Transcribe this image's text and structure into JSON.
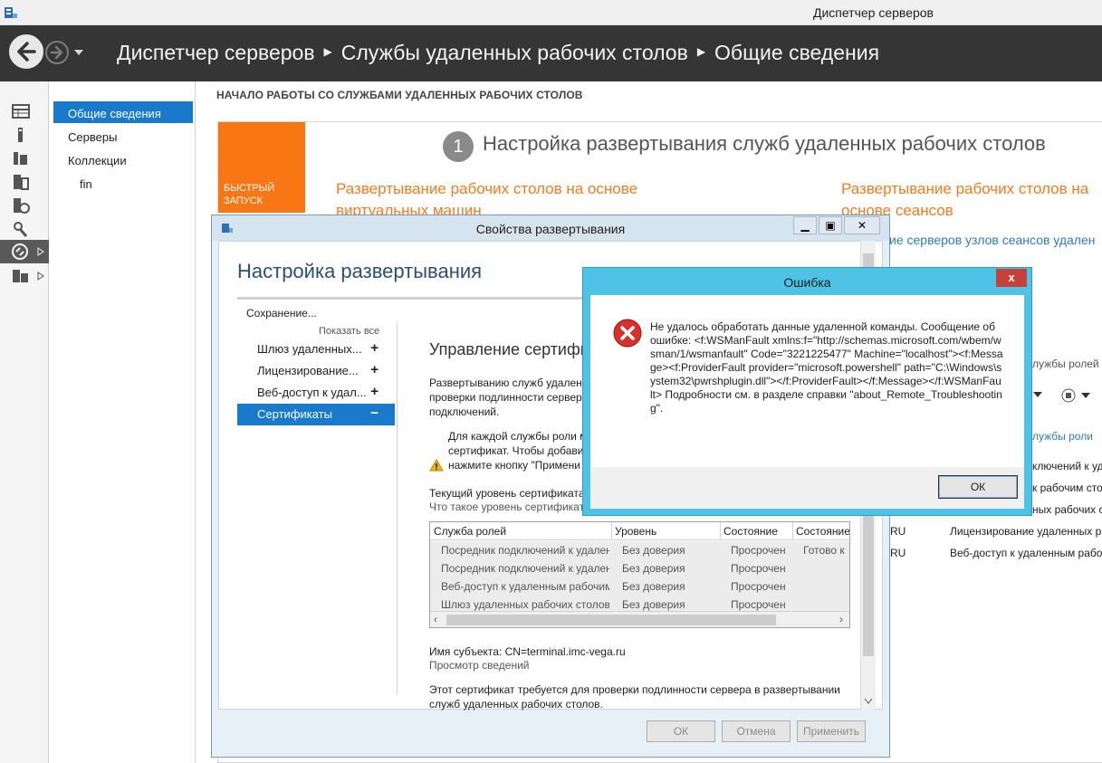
{
  "window": {
    "title": "Диспетчер серверов"
  },
  "nav": {
    "breadcrumb": [
      "Диспетчер серверов",
      "Службы удаленных рабочих столов",
      "Общие сведения"
    ]
  },
  "sidebar": {
    "items": [
      {
        "label": "Общие сведения",
        "active": true
      },
      {
        "label": "Серверы"
      },
      {
        "label": "Коллекции"
      },
      {
        "label": "fin"
      }
    ]
  },
  "main": {
    "heading": "НАЧАЛО РАБОТЫ СО СЛУЖБАМИ УДАЛЕННЫХ РАБОЧИХ СТОЛОВ",
    "quickstart_label": "БЫСТРЫЙ ЗАПУСК",
    "step_number": "1",
    "step_title": "Настройка развертывания служб удаленных рабочих столов",
    "link_vdi": "Развертывание рабочих столов на основе виртуальных машин",
    "link_session": "Развертывание рабочих столов на основе сеансов",
    "link_add_servers": "ие серверов узлов сеансов удален",
    "bg_role_services": "службы ролей уд",
    "bg_task_link": "службы роли",
    "bg_rows": [
      "ключений к удал",
      "к рабочим сто",
      "ных рабочих стол"
    ],
    "bg_ru": [
      "RU",
      "RU"
    ],
    "bg_roles": [
      "Лицензирование удаленных ра",
      "Веб-доступ к удаленным рабо"
    ]
  },
  "deploy_dialog": {
    "title": "Свойства развертывания",
    "heading": "Настройка развертывания",
    "status": "Сохранение...",
    "show_all": "Показать все",
    "nav": [
      {
        "label": "Шлюз удаленных...",
        "sign": "+"
      },
      {
        "label": "Лицензирование...",
        "sign": "+"
      },
      {
        "label": "Веб-доступ к удал...",
        "sign": "+"
      },
      {
        "label": "Сертификаты",
        "sign": "−",
        "active": true
      }
    ],
    "section_title": "Управление сертифи",
    "desc": [
      "Развертыванию служб удален",
      "проверки подлинности сервер",
      "подключений."
    ],
    "warning": [
      "Для каждой службы роли м",
      "сертификат. Чтобы добавит",
      "нажмите кнопку \"Примени"
    ],
    "cert_level_label": "Текущий уровень сертификата",
    "cert_level_link": "Что такое уровень сертификата",
    "grid": {
      "columns": [
        "Служба ролей",
        "Уровень",
        "Состояние",
        "Состояние"
      ],
      "rows": [
        [
          "Посредник подключений к удален",
          "Без доверия",
          "Просрочен",
          "Готово к"
        ],
        [
          "Посредник подключений к удален",
          "Без доверия",
          "Просрочен",
          ""
        ],
        [
          "Веб-доступ к удаленным рабочим",
          "Без доверия",
          "Просрочен",
          ""
        ],
        [
          "Шлюз удаленных рабочих столов",
          "Без доверия",
          "Просрочен",
          ""
        ]
      ]
    },
    "subject": "Имя субъекта: CN=terminal.imc-vega.ru",
    "view_details": "Просмотр сведений",
    "footer_text": [
      "Этот сертификат требуется для проверки подлинности сервера в развертывании",
      "служб удаленных рабочих столов."
    ],
    "buttons": {
      "ok": "ОК",
      "cancel": "Отмена",
      "apply": "Применить"
    }
  },
  "error_dialog": {
    "title": "Ошибка",
    "message": "Не удалось обработать данные удаленной команды. Сообщение об ошибке: <f:WSManFault xmlns:f=\"http://schemas.microsoft.com/wbem/wsman/1/wsmanfault\" Code=\"3221225477\" Machine=\"localhost\"><f:Message><f:ProviderFault provider=\"microsoft.powershell\" path=\"C:\\Windows\\system32\\pwrshplugin.dll\"></f:ProviderFault></f:Message></f:WSManFault> Подробности см. в разделе справки \"about_Remote_Troubleshooting\".",
    "ok": "ОК",
    "close": "x"
  },
  "colors": {
    "accent": "#1979ca",
    "orange": "#f97615",
    "error_frame": "#4fc3e6",
    "nav_bg": "#353535"
  }
}
